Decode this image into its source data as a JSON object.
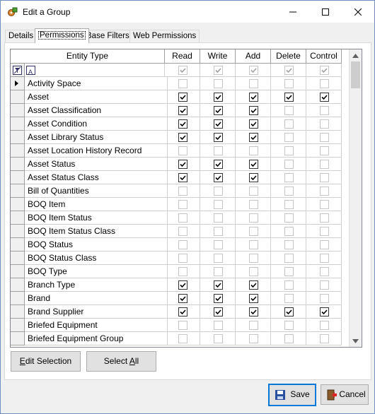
{
  "window": {
    "title": "Edit a Group"
  },
  "tabs": [
    {
      "label": "Details"
    },
    {
      "label": "Permissions"
    },
    {
      "label": "Base Filters"
    },
    {
      "label": "Web Permissions"
    }
  ],
  "grid": {
    "columns": {
      "entity": "Entity Type",
      "read": "Read",
      "write": "Write",
      "add": "Add",
      "delete": "Delete",
      "control": "Control"
    },
    "filter_row": {
      "read": true,
      "write": true,
      "add": true,
      "delete": true,
      "control": true
    },
    "rows": [
      {
        "name": "Activity Space",
        "current": true,
        "read": false,
        "write": false,
        "add": false,
        "delete": false,
        "control": false
      },
      {
        "name": "Asset",
        "read": true,
        "write": true,
        "add": true,
        "delete": true,
        "control": true
      },
      {
        "name": "Asset Classification",
        "read": true,
        "write": true,
        "add": true,
        "delete": false,
        "control": false
      },
      {
        "name": "Asset Condition",
        "read": true,
        "write": true,
        "add": true,
        "delete": false,
        "control": false
      },
      {
        "name": "Asset Library Status",
        "read": true,
        "write": true,
        "add": true,
        "delete": false,
        "control": false
      },
      {
        "name": "Asset Location History Record",
        "read": false,
        "write": false,
        "add": false,
        "delete": false,
        "control": false
      },
      {
        "name": "Asset Status",
        "read": true,
        "write": true,
        "add": true,
        "delete": false,
        "control": false
      },
      {
        "name": "Asset Status Class",
        "read": true,
        "write": true,
        "add": true,
        "delete": false,
        "control": false
      },
      {
        "name": "Bill of Quantities",
        "read": false,
        "write": false,
        "add": false,
        "delete": false,
        "control": false
      },
      {
        "name": "BOQ Item",
        "read": false,
        "write": false,
        "add": false,
        "delete": false,
        "control": false
      },
      {
        "name": "BOQ Item Status",
        "read": false,
        "write": false,
        "add": false,
        "delete": false,
        "control": false
      },
      {
        "name": "BOQ Item Status Class",
        "read": false,
        "write": false,
        "add": false,
        "delete": false,
        "control": false
      },
      {
        "name": "BOQ Status",
        "read": false,
        "write": false,
        "add": false,
        "delete": false,
        "control": false
      },
      {
        "name": "BOQ Status Class",
        "read": false,
        "write": false,
        "add": false,
        "delete": false,
        "control": false
      },
      {
        "name": "BOQ Type",
        "read": false,
        "write": false,
        "add": false,
        "delete": false,
        "control": false
      },
      {
        "name": "Branch Type",
        "read": true,
        "write": true,
        "add": true,
        "delete": false,
        "control": false
      },
      {
        "name": "Brand",
        "read": true,
        "write": true,
        "add": true,
        "delete": false,
        "control": false
      },
      {
        "name": "Brand Supplier",
        "read": true,
        "write": true,
        "add": true,
        "delete": true,
        "control": true
      },
      {
        "name": "Briefed Equipment",
        "read": false,
        "write": false,
        "add": false,
        "delete": false,
        "control": false
      },
      {
        "name": "Briefed Equipment Group",
        "read": false,
        "write": false,
        "add": false,
        "delete": false,
        "control": false
      }
    ]
  },
  "buttons": {
    "edit_selection_access": "E",
    "edit_selection_rest": "dit Selection",
    "select_all_pre": "Select ",
    "select_all_access": "A",
    "select_all_rest": "ll",
    "save": "Save",
    "cancel": "Cancel"
  }
}
